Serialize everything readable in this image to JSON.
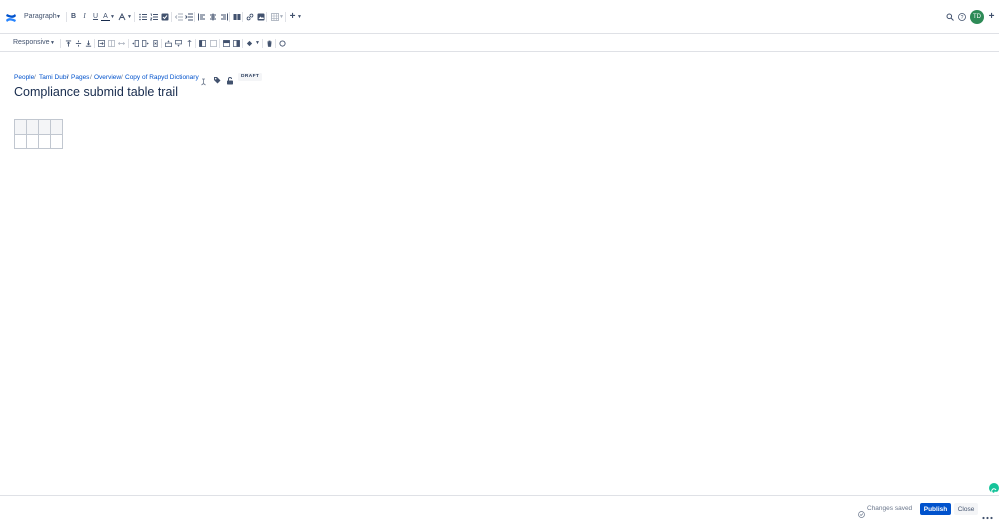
{
  "toolbar": {
    "text_style": "Paragraph",
    "table_layout": "Responsive",
    "user_initials": "TD"
  },
  "breadcrumb": {
    "items": [
      "People",
      "Tami Dubi",
      "Pages",
      "Overview",
      "Copy of Rapyd Dictionary"
    ],
    "status_badge": "DRAFT"
  },
  "page": {
    "title": "Compliance submid table trail"
  },
  "table": {
    "rows": 2,
    "columns": 4
  },
  "footer": {
    "status": "Changes saved",
    "publish_label": "Publish",
    "close_label": "Close"
  },
  "colors": {
    "brand": "#0052cc",
    "text": "#172b4d",
    "muted": "#42526e",
    "avatar": "#2e8b57",
    "grammarly": "#15c39a"
  }
}
